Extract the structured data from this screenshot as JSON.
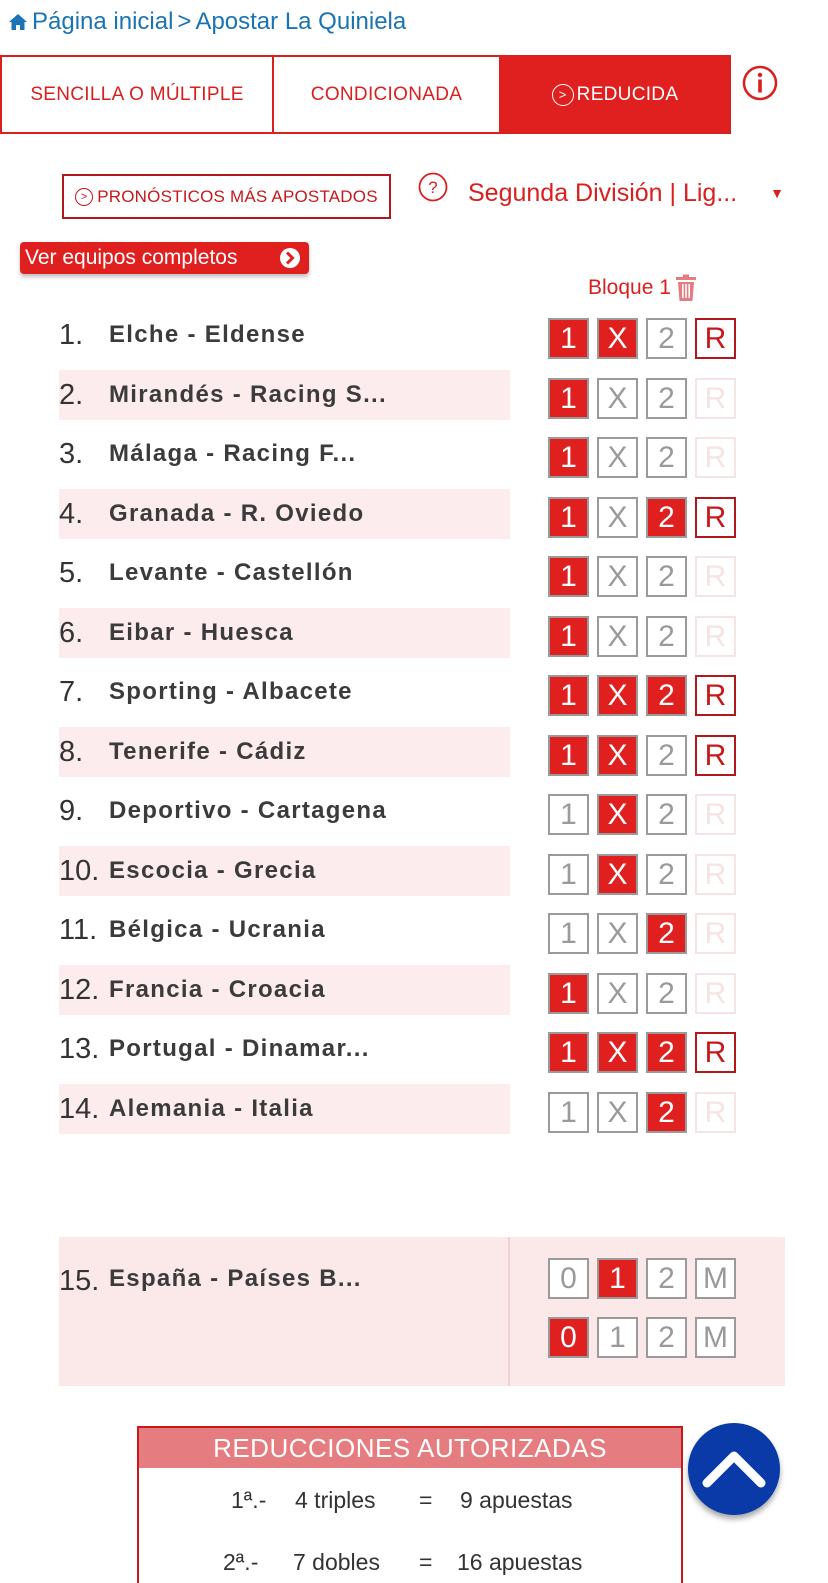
{
  "breadcrumb": {
    "home": "Página inicial",
    "separator": ">",
    "current": "Apostar La Quiniela"
  },
  "tabs": [
    {
      "label": "SENCILLA O MÚLTIPLE",
      "active": false
    },
    {
      "label": "CONDICIONADA",
      "active": false
    },
    {
      "label": "REDUCIDA",
      "active": true
    }
  ],
  "toolbar": {
    "pronosticos_label": "PRONÓSTICOS MÁS APOSTADOS",
    "league_selected": "Segunda División | Lig...",
    "teams_button": "Ver equipos completos"
  },
  "block": {
    "label": "Bloque 1"
  },
  "matches": [
    {
      "num": "1.",
      "name": "Elche - Eldense",
      "picks": [
        true,
        true,
        false
      ],
      "r": true
    },
    {
      "num": "2.",
      "name": "Mirandés - Racing S...",
      "picks": [
        true,
        false,
        false
      ],
      "r": false
    },
    {
      "num": "3.",
      "name": "Málaga - Racing F...",
      "picks": [
        true,
        false,
        false
      ],
      "r": false
    },
    {
      "num": "4.",
      "name": "Granada - R. Oviedo",
      "picks": [
        true,
        false,
        true
      ],
      "r": true
    },
    {
      "num": "5.",
      "name": "Levante - Castellón",
      "picks": [
        true,
        false,
        false
      ],
      "r": false
    },
    {
      "num": "6.",
      "name": "Eibar - Huesca",
      "picks": [
        true,
        false,
        false
      ],
      "r": false
    },
    {
      "num": "7.",
      "name": "Sporting - Albacete",
      "picks": [
        true,
        true,
        true
      ],
      "r": true
    },
    {
      "num": "8.",
      "name": "Tenerife - Cádiz",
      "picks": [
        true,
        true,
        false
      ],
      "r": true
    },
    {
      "num": "9.",
      "name": "Deportivo - Cartagena",
      "picks": [
        false,
        true,
        false
      ],
      "r": false
    },
    {
      "num": "10.",
      "name": "Escocia - Grecia",
      "picks": [
        false,
        true,
        false
      ],
      "r": false
    },
    {
      "num": "11.",
      "name": "Bélgica - Ucrania",
      "picks": [
        false,
        false,
        true
      ],
      "r": false
    },
    {
      "num": "12.",
      "name": "Francia - Croacia",
      "picks": [
        true,
        false,
        false
      ],
      "r": false
    },
    {
      "num": "13.",
      "name": "Portugal - Dinamar...",
      "picks": [
        true,
        true,
        true
      ],
      "r": true
    },
    {
      "num": "14.",
      "name": "Alemania - Italia",
      "picks": [
        false,
        false,
        true
      ],
      "r": false
    }
  ],
  "cell_labels": [
    "1",
    "X",
    "2",
    "R"
  ],
  "pleno": {
    "num": "15.",
    "name": "España - Países B...",
    "labels": [
      "0",
      "1",
      "2",
      "M"
    ],
    "home_selected": "1",
    "away_selected": "0"
  },
  "reducciones": {
    "title": "REDUCCIONES AUTORIZADAS",
    "rows": [
      {
        "ord": "1ª.-",
        "desc": "4 triples",
        "eq": "=",
        "res": "9 apuestas"
      },
      {
        "ord": "2ª.-",
        "desc": "7 dobles",
        "eq": "=",
        "res": "16 apuestas"
      }
    ]
  },
  "colors": {
    "accent": "#e01f1f",
    "link": "#1a73b5",
    "scroll_button": "#0a3aa8"
  }
}
